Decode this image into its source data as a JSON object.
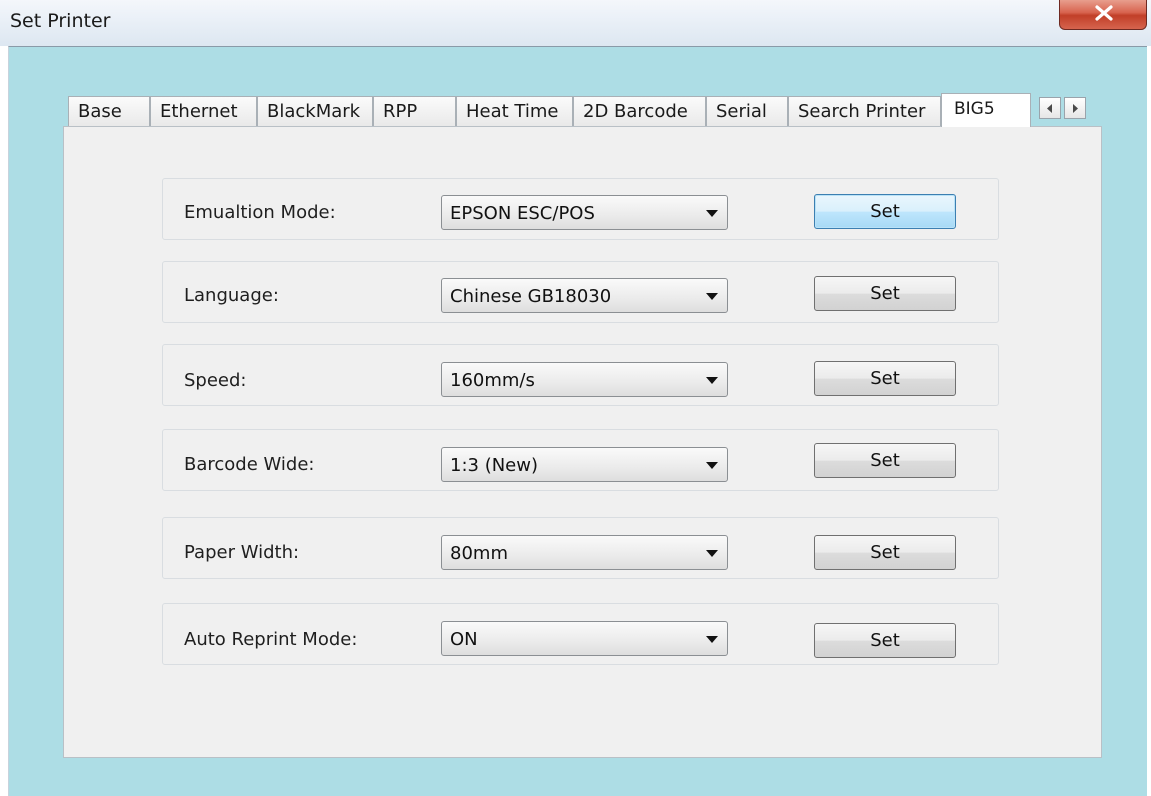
{
  "window": {
    "title": "Set Printer",
    "close_icon": "close-icon"
  },
  "tabs": [
    {
      "label": "Base"
    },
    {
      "label": "Ethernet"
    },
    {
      "label": "BlackMark"
    },
    {
      "label": "RPP"
    },
    {
      "label": "Heat Time"
    },
    {
      "label": "2D Barcode"
    },
    {
      "label": "Serial"
    },
    {
      "label": "Search Printer"
    },
    {
      "label": "BIG5",
      "active": true
    }
  ],
  "tab_scroll": {
    "left_icon": "arrow-left-icon",
    "right_icon": "arrow-right-icon"
  },
  "settings": [
    {
      "label": "Emualtion Mode:",
      "value": "EPSON ESC/POS",
      "button": "Set"
    },
    {
      "label": "Language:",
      "value": "Chinese GB18030",
      "button": "Set"
    },
    {
      "label": "Speed:",
      "value": "160mm/s",
      "button": "Set"
    },
    {
      "label": "Barcode Wide:",
      "value": "1:3 (New)",
      "button": "Set"
    },
    {
      "label": "Paper Width:",
      "value": "80mm",
      "button": "Set"
    },
    {
      "label": "Auto Reprint Mode:",
      "value": "ON",
      "button": "Set"
    }
  ],
  "colors": {
    "frame_background": "#addde5",
    "panel_background": "#f0f0f0",
    "close_button": "#c13f28"
  }
}
